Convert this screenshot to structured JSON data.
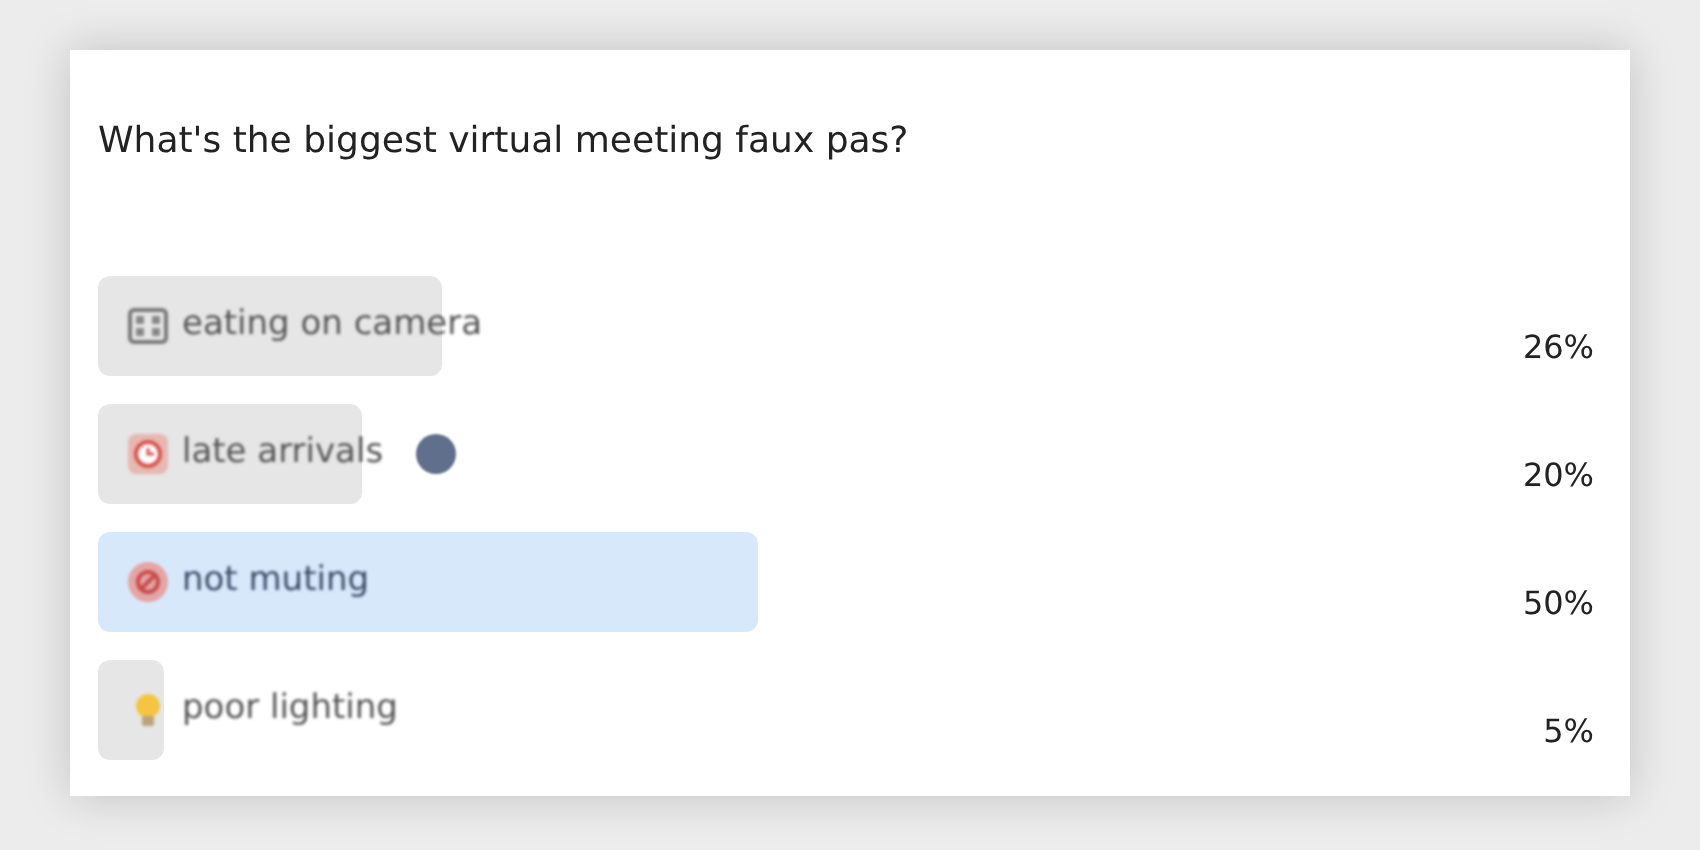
{
  "question": "What's the biggest virtual meeting faux pas?",
  "options": [
    {
      "kind": "film",
      "label": "eating on camera",
      "percent": "26%",
      "leading": false,
      "voted": false
    },
    {
      "kind": "clock",
      "label": "late arrivals",
      "percent": "20%",
      "leading": false,
      "voted": true
    },
    {
      "kind": "mute",
      "label": "not muting",
      "percent": "50%",
      "leading": true,
      "voted": false
    },
    {
      "kind": "bulb",
      "label": "poor lighting",
      "percent": "5%",
      "leading": false,
      "voted": false
    }
  ]
}
